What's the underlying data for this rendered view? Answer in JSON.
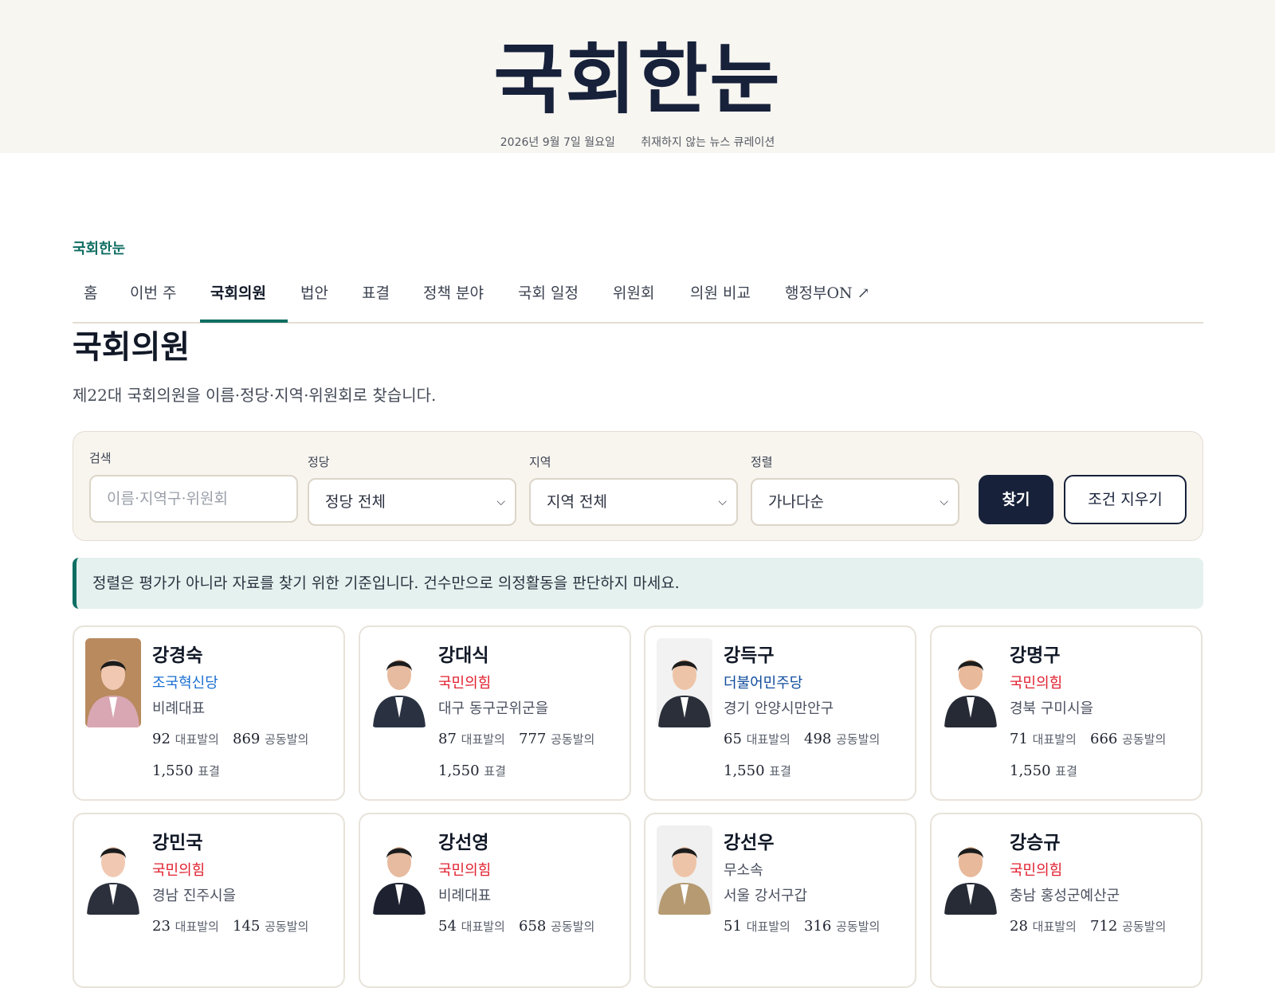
{
  "masthead": {
    "logo": "국회한눈",
    "date": "2026년 9월 7일 월요일",
    "tagline": "취재하지 않는 뉴스 큐레이션"
  },
  "breadcrumb": "국회한눈",
  "nav": {
    "items": [
      "홈",
      "이번 주",
      "국회의원",
      "법안",
      "표결",
      "정책 분야",
      "국회 일정",
      "위원회",
      "의원 비교",
      "행정부ON ↗"
    ],
    "active": "국회의원"
  },
  "page": {
    "title": "국회의원",
    "description": "제22대 국회의원을 이름·정당·지역·위원회로 찾습니다."
  },
  "filters": {
    "search_label": "검색",
    "search_placeholder": "이름·지역구·위원회",
    "party_label": "정당",
    "party_value": "정당 전체",
    "region_label": "지역",
    "region_value": "지역 전체",
    "sort_label": "정렬",
    "sort_value": "가나다순",
    "search_button": "찾기",
    "clear_button": "조건 지우기"
  },
  "notice": "정렬은 평가가 아니라 자료를 찾기 위한 기준입니다. 건수만으로 의정활동을 판단하지 마세요.",
  "labels": {
    "lead": "대표발의",
    "co": "공동발의",
    "votes": "표결"
  },
  "colors": {
    "accent": "#0f6e63",
    "navy": "#17213a",
    "ppp": "#e0202f",
    "dpk": "#0f4c9c",
    "rebuild": "#1a6fd1",
    "indep": "#4b5160"
  },
  "members": [
    {
      "name": "강경숙",
      "party": "조국혁신당",
      "party_color": "#1a6fd1",
      "region": "비례대표",
      "lead": "92",
      "co": "869",
      "votes": "1,550"
    },
    {
      "name": "강대식",
      "party": "국민의힘",
      "party_color": "#e0202f",
      "region": "대구 동구군위군을",
      "lead": "87",
      "co": "777",
      "votes": "1,550"
    },
    {
      "name": "강득구",
      "party": "더불어민주당",
      "party_color": "#0f4c9c",
      "region": "경기 안양시만안구",
      "lead": "65",
      "co": "498",
      "votes": "1,550"
    },
    {
      "name": "강명구",
      "party": "국민의힘",
      "party_color": "#e0202f",
      "region": "경북 구미시을",
      "lead": "71",
      "co": "666",
      "votes": "1,550"
    },
    {
      "name": "강민국",
      "party": "국민의힘",
      "party_color": "#e0202f",
      "region": "경남 진주시을",
      "lead": "23",
      "co": "145",
      "votes": ""
    },
    {
      "name": "강선영",
      "party": "국민의힘",
      "party_color": "#e0202f",
      "region": "비례대표",
      "lead": "54",
      "co": "658",
      "votes": ""
    },
    {
      "name": "강선우",
      "party": "무소속",
      "party_color": "#4b5160",
      "region": "서울 강서구갑",
      "lead": "51",
      "co": "316",
      "votes": ""
    },
    {
      "name": "강승규",
      "party": "국민의힘",
      "party_color": "#e0202f",
      "region": "충남 홍성군예산군",
      "lead": "28",
      "co": "712",
      "votes": ""
    }
  ]
}
